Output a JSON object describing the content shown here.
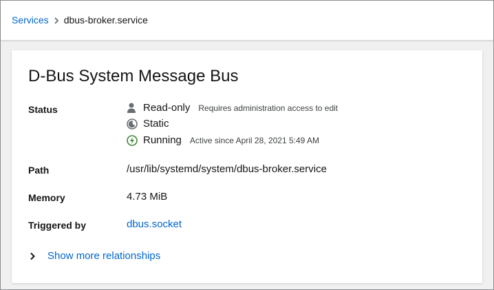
{
  "breadcrumb": {
    "parent": "Services",
    "current": "dbus-broker.service"
  },
  "service": {
    "title": "D-Bus System Message Bus",
    "status_label": "Status",
    "status": [
      {
        "icon": "user-icon",
        "text": "Read-only",
        "note": "Requires administration access to edit"
      },
      {
        "icon": "static-moon-icon",
        "text": "Static",
        "note": ""
      },
      {
        "icon": "running-bolt-icon",
        "text": "Running",
        "note": "Active since April 28, 2021 5:49 AM"
      }
    ],
    "path_label": "Path",
    "path": "/usr/lib/systemd/system/dbus-broker.service",
    "memory_label": "Memory",
    "memory": "4.73 MiB",
    "triggered_label": "Triggered by",
    "triggered_by": "dbus.socket",
    "more_relationships": "Show more relationships"
  },
  "colors": {
    "link": "#0066cc",
    "running": "#3e8635",
    "icon_gray": "#6a6e73"
  }
}
